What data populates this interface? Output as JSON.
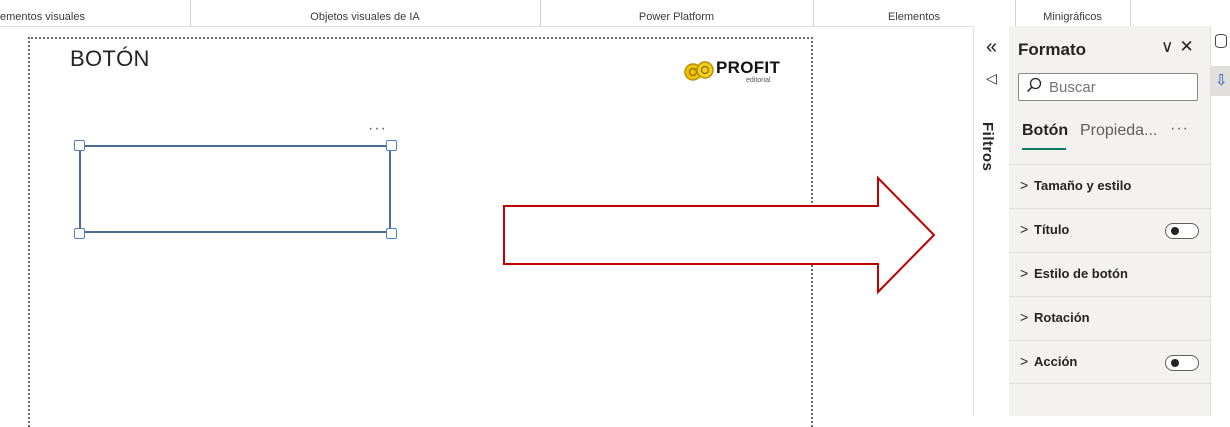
{
  "ribbon": {
    "groups": [
      "ementos visuales",
      "Objetos visuales de IA",
      "Power Platform",
      "Elementos",
      "Minigráficos"
    ]
  },
  "canvas": {
    "title": "BOTÓN",
    "logo": {
      "word": "PROFIT",
      "sub": "editorial"
    },
    "visual_more": "···"
  },
  "filters": {
    "label": "Filtros",
    "collapse_icon": "double-chevron-left-icon",
    "funnel_icon": "filter-icon"
  },
  "format_pane": {
    "title": "Formato",
    "search_placeholder": "Buscar",
    "tabs": [
      {
        "label": "Botón",
        "active": true
      },
      {
        "label": "Propieda...",
        "active": false
      }
    ],
    "tabs_more": "···",
    "sections": [
      {
        "label": "Tamaño y estilo",
        "toggle": null
      },
      {
        "label": "Título",
        "toggle": "off"
      },
      {
        "label": "Estilo de botón",
        "toggle": null
      },
      {
        "label": "Rotación",
        "toggle": null
      },
      {
        "label": "Acción",
        "toggle": "off"
      }
    ]
  },
  "colors": {
    "arrow": "#c00000",
    "selection": "#4b6b91",
    "handle": "#4b82c4",
    "active_tab_underline": "#117865",
    "pane_bg": "#f3f2f1"
  }
}
